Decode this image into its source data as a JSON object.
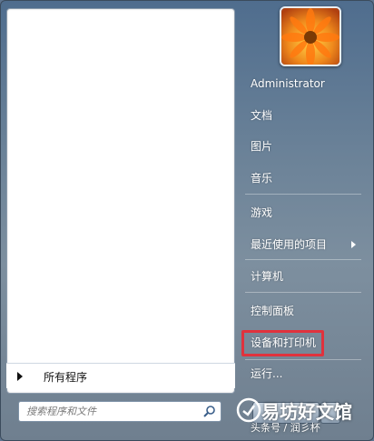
{
  "start_menu": {
    "all_programs_label": "所有程序",
    "search_placeholder": "搜索程序和文件",
    "right_items": {
      "user": "Administrator",
      "documents": "文档",
      "pictures": "图片",
      "music": "音乐",
      "games": "游戏",
      "recent_items": "最近使用的项目",
      "computer": "计算机",
      "control_panel": "控制面板",
      "devices_printers": "设备和打印机",
      "run": "运行..."
    }
  },
  "watermark": {
    "title": "易坊好文馆",
    "subtitle": "头条号 / 润彡杯"
  },
  "colors": {
    "highlight_border": "#e0323d",
    "menu_text": "#ffffff"
  }
}
